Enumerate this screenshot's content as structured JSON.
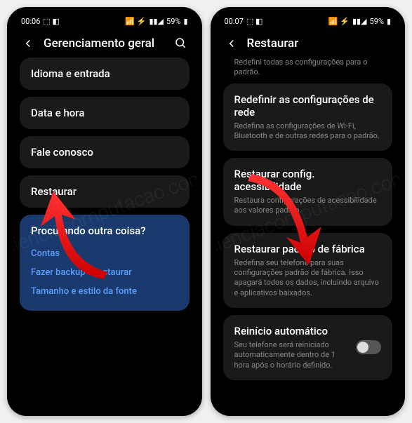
{
  "phone1": {
    "status": {
      "time": "00:06",
      "battery": "59%"
    },
    "header": {
      "title": "Gerenciamento geral"
    },
    "items": [
      {
        "title": "Idioma e entrada"
      },
      {
        "title": "Data e hora"
      },
      {
        "title": "Fale conosco"
      },
      {
        "title": "Restaurar"
      }
    ],
    "suggest": {
      "title": "Procurando outra coisa?",
      "links": [
        "Contas",
        "Fazer backup e restaurar",
        "Tamanho e estilo da fonte"
      ]
    }
  },
  "phone2": {
    "status": {
      "time": "00:07",
      "battery": "59%"
    },
    "header": {
      "title": "Restaurar"
    },
    "topdesc": "Redefini todas as configurações para o padrão.",
    "items": [
      {
        "title": "Redefinir as configurações de rede",
        "desc": "Redefina as configurações de Wi-Fi, Bluetooth e de outras redes para o padrão."
      },
      {
        "title": "Restaurar config. acessibilidade",
        "desc": "Restaura configurações de acessibilidade aos valores padrão."
      },
      {
        "title": "Restaurar padrão de fábrica",
        "desc": "Redefina seu telefone para suas configurações padrão de fábrica. Isso apagará todos os dados, incluindo arquivo e aplicativos baixados."
      }
    ],
    "toggle": {
      "title": "Reinício automático",
      "desc": "Seu telefone será reiniciado automaticamente dentro de 1 hora após o horário definido.",
      "on": false
    }
  },
  "watermark": "cienciacomputacao.com"
}
